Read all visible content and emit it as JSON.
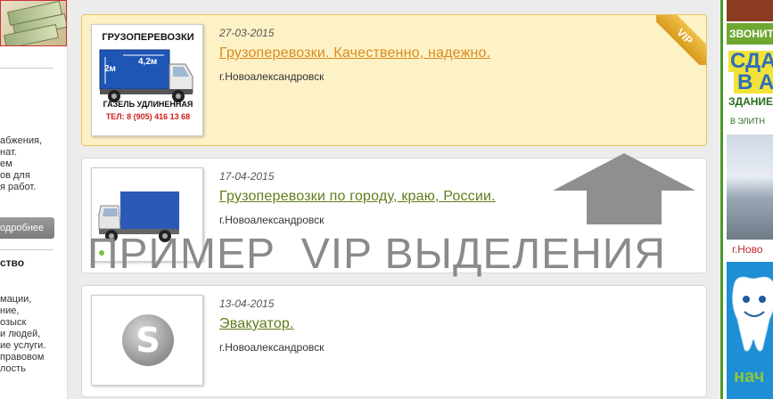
{
  "left_sidebar": {
    "text_block_1": "абжения,\nнат.\nем\nов для\nя работ.",
    "more_button": "одробнее",
    "heading": "ство",
    "text_block_2": "мации,\nние,\nозыск\nи людей,\nие услуги.\nправовом\nлость"
  },
  "listings": [
    {
      "vip": true,
      "ribbon": "VIP",
      "date": "27-03-2015",
      "title": "Грузоперевозки. Качественно, надежно.",
      "city": "г.Новоалександровск",
      "thumb": {
        "heading": "ГРУЗОПЕРЕВОЗКИ",
        "dim_height": "2м",
        "dim_length": "4,2м",
        "footer": "ГАЗЕЛЬ УДЛИНЕННАЯ",
        "phone": "ТЕЛ: 8 (905) 416 13 68"
      }
    },
    {
      "vip": false,
      "date": "17-04-2015",
      "title": "Грузоперевозки по городу, краю, России.",
      "city": "г.Новоалександровск"
    },
    {
      "vip": false,
      "date": "13-04-2015",
      "title": "Эвакуатор.",
      "city": "г.Новоалександровск",
      "thumb_letter": "S"
    }
  ],
  "overlay": {
    "caption": "ПРИМЕР  VIP ВЫДЕЛЕНИЯ"
  },
  "right_sidebar": {
    "banner1_text": "ЗВОНИТ",
    "banner2_big1": "СДА",
    "banner2_big2": "В А",
    "banner2_line": "ЗДАНИЕ",
    "banner2_sub": "В ЭЛИТН",
    "banner2_city": "г.Ново",
    "banner3_text": "нач"
  },
  "colors": {
    "vip_background": "#fdf1c6",
    "vip_border": "#e7c55b",
    "vip_title": "#d98b1e",
    "title_link": "#5e7d1a",
    "overlay_gray": "#8a8a8a",
    "right_border": "#4c9a2a"
  }
}
